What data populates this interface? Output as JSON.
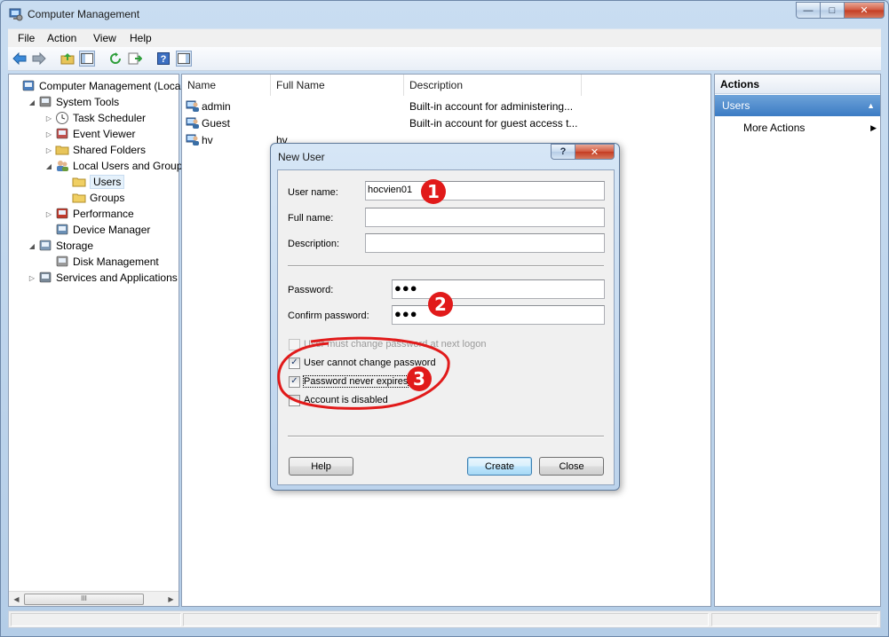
{
  "window": {
    "title": "Computer Management",
    "caption": {
      "minimize": "—",
      "maximize": "□",
      "close": "✕"
    }
  },
  "menu": [
    "File",
    "Action",
    "View",
    "Help"
  ],
  "tree": [
    {
      "label": "Computer Management (Local",
      "indent": 0,
      "arrow": "",
      "icon": "computer-icon"
    },
    {
      "label": "System Tools",
      "indent": 1,
      "arrow": "◢",
      "icon": "tools-icon"
    },
    {
      "label": "Task Scheduler",
      "indent": 2,
      "arrow": "▷",
      "icon": "clock-icon"
    },
    {
      "label": "Event Viewer",
      "indent": 2,
      "arrow": "▷",
      "icon": "event-viewer-icon"
    },
    {
      "label": "Shared Folders",
      "indent": 2,
      "arrow": "▷",
      "icon": "shared-folder-icon"
    },
    {
      "label": "Local Users and Groups",
      "indent": 2,
      "arrow": "◢",
      "icon": "users-groups-icon"
    },
    {
      "label": "Users",
      "indent": 3,
      "arrow": "",
      "icon": "folder-icon",
      "selected": true
    },
    {
      "label": "Groups",
      "indent": 3,
      "arrow": "",
      "icon": "folder-icon"
    },
    {
      "label": "Performance",
      "indent": 2,
      "arrow": "▷",
      "icon": "performance-icon"
    },
    {
      "label": "Device Manager",
      "indent": 2,
      "arrow": "",
      "icon": "device-manager-icon"
    },
    {
      "label": "Storage",
      "indent": 1,
      "arrow": "◢",
      "icon": "storage-icon"
    },
    {
      "label": "Disk Management",
      "indent": 2,
      "arrow": "",
      "icon": "disk-icon"
    },
    {
      "label": "Services and Applications",
      "indent": 1,
      "arrow": "▷",
      "icon": "services-icon"
    }
  ],
  "scroll_thumb": "III",
  "list": {
    "columns": [
      "Name",
      "Full Name",
      "Description"
    ],
    "rows": [
      {
        "name": "admin",
        "full_name": "",
        "description": "Built-in account for administering..."
      },
      {
        "name": "Guest",
        "full_name": "",
        "description": "Built-in account for guest access t..."
      },
      {
        "name": "hv",
        "full_name": "hv",
        "description": ""
      }
    ]
  },
  "actions": {
    "header": "Actions",
    "section": "Users",
    "section_arrow": "▲",
    "item": "More Actions",
    "item_arrow": "▶"
  },
  "dialog": {
    "title": "New User",
    "help_caption": "?",
    "close_caption": "✕",
    "username_label": "User name:",
    "username_value": "hocvien01",
    "fullname_label": "Full name:",
    "fullname_value": "",
    "description_label": "Description:",
    "description_value": "",
    "password_label": "Password:",
    "password_value": "●●●",
    "confirm_label": "Confirm password:",
    "confirm_value": "●●●",
    "checkboxes": [
      {
        "label": "User must change password at next logon",
        "checked": false,
        "disabled": true
      },
      {
        "label": "User cannot change password",
        "checked": true,
        "disabled": false
      },
      {
        "label": "Password never expires",
        "checked": true,
        "disabled": false,
        "focused": true
      },
      {
        "label": "Account is disabled",
        "checked": false,
        "disabled": false
      }
    ],
    "check_mark": "✓",
    "buttons": {
      "help": "Help",
      "create": "Create",
      "close": "Close"
    }
  },
  "annotations": [
    "1",
    "2",
    "3"
  ],
  "colors": {
    "annotation_red": "#e11a1a",
    "selection_blue": "#3b7bc4"
  }
}
